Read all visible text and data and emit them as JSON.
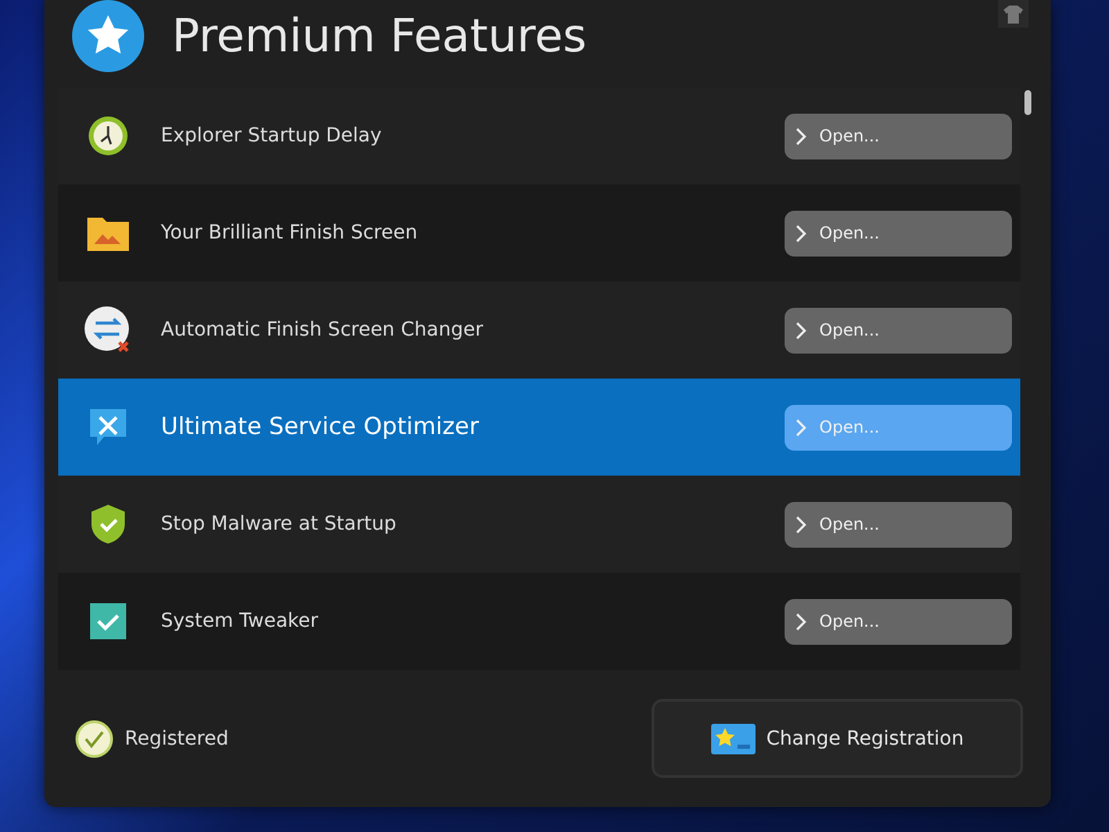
{
  "window": {
    "title": "Premium Features"
  },
  "features": [
    {
      "kind": "clock",
      "label": "Explorer Startup Delay",
      "button": "Open...",
      "selected": false
    },
    {
      "kind": "folder",
      "label": "Your Brilliant Finish Screen",
      "button": "Open...",
      "selected": false
    },
    {
      "kind": "swap",
      "label": "Automatic Finish Screen Changer",
      "button": "Open...",
      "selected": false
    },
    {
      "kind": "tools",
      "label": "Ultimate Service Optimizer",
      "button": "Open...",
      "selected": true
    },
    {
      "kind": "shield",
      "label": "Stop Malware at Startup",
      "button": "Open...",
      "selected": false
    },
    {
      "kind": "check",
      "label": "System Tweaker",
      "button": "Open...",
      "selected": false
    }
  ],
  "footer": {
    "status": "Registered",
    "button": "Change Registration"
  }
}
